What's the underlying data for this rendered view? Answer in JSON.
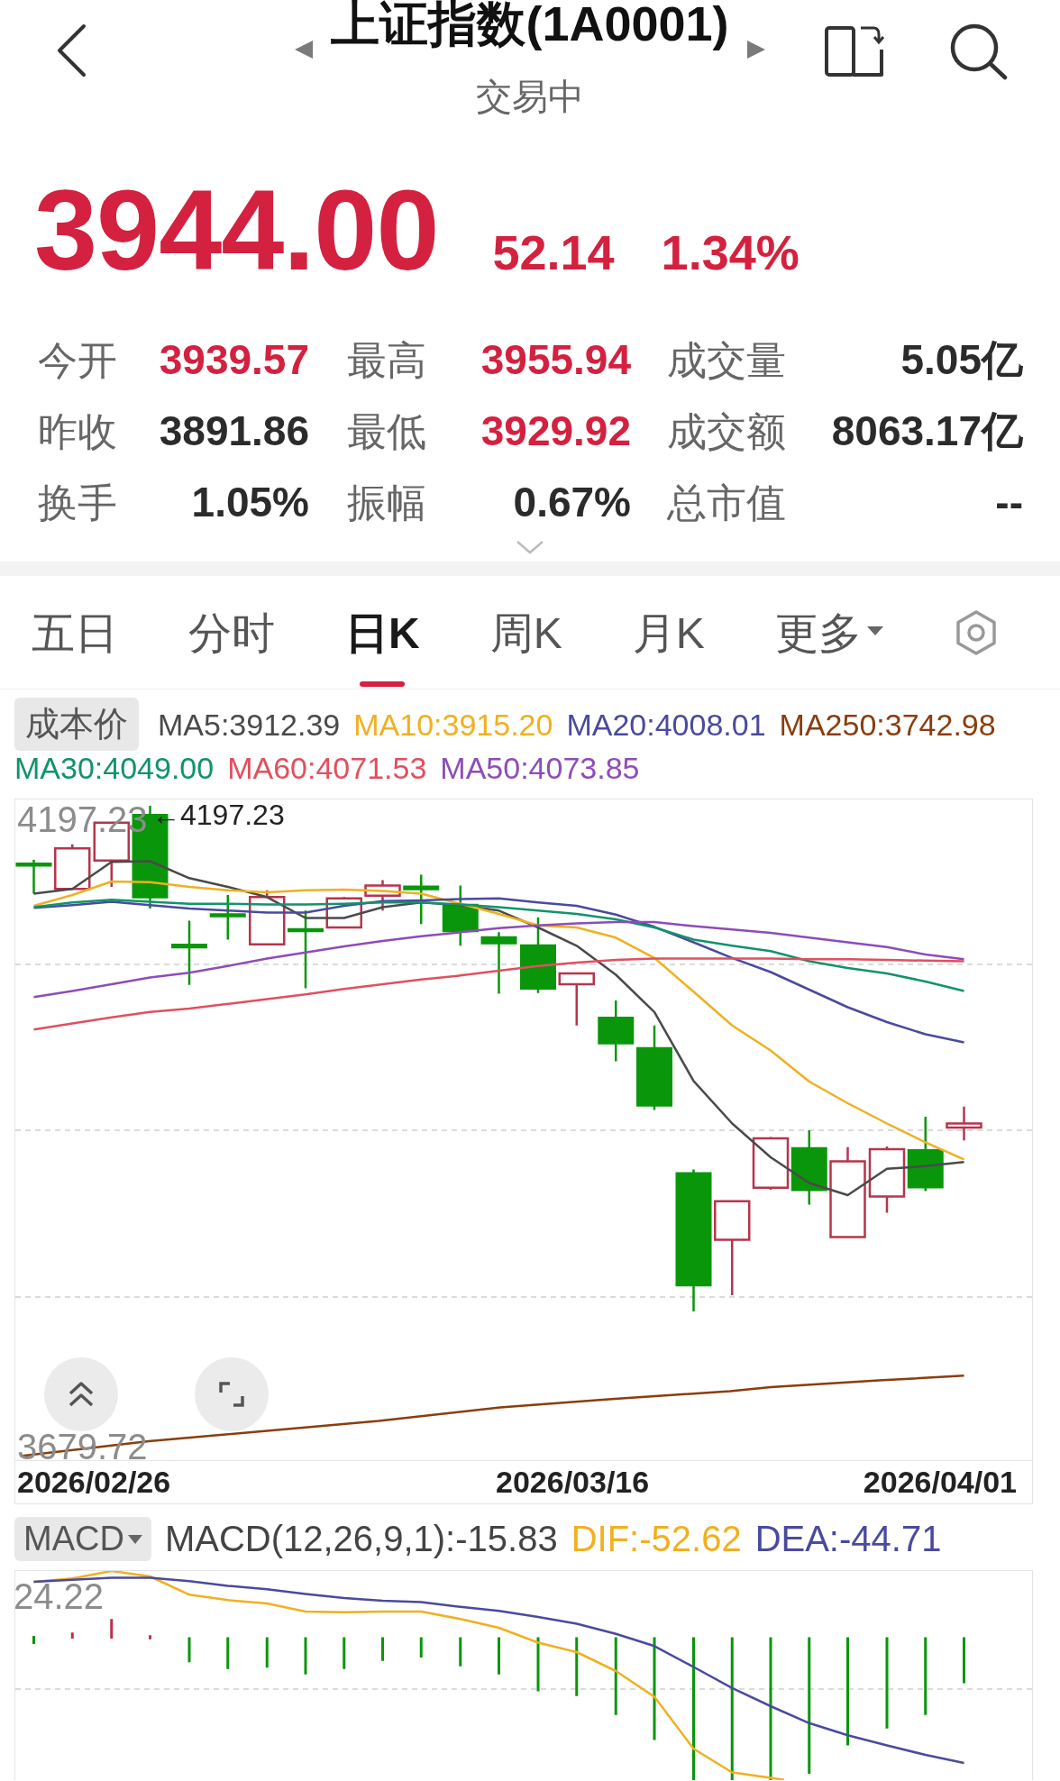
{
  "header": {
    "title": "上证指数(1A0001)",
    "status": "交易中"
  },
  "quote": {
    "price": "3944.00",
    "change": "52.14",
    "change_percent": "1.34%",
    "rising": true
  },
  "stats": [
    {
      "label": "今开",
      "value": "3939.57",
      "rising": true
    },
    {
      "label": "最高",
      "value": "3955.94",
      "rising": true
    },
    {
      "label": "成交量",
      "value": "5.05亿",
      "rising": false
    },
    {
      "label": "昨收",
      "value": "3891.86",
      "rising": false
    },
    {
      "label": "最低",
      "value": "3929.92",
      "rising": true
    },
    {
      "label": "成交额",
      "value": "8063.17亿",
      "rising": false
    },
    {
      "label": "换手",
      "value": "1.05%",
      "rising": false
    },
    {
      "label": "振幅",
      "value": "0.67%",
      "rising": false
    },
    {
      "label": "总市值",
      "value": "--",
      "rising": false
    }
  ],
  "tabs": [
    {
      "label": "五日",
      "selected": false,
      "kind": "plain"
    },
    {
      "label": "分时",
      "selected": false,
      "kind": "plain"
    },
    {
      "label": "日K",
      "selected": true,
      "kind": "plain"
    },
    {
      "label": "周K",
      "selected": false,
      "kind": "plain"
    },
    {
      "label": "月K",
      "selected": false,
      "kind": "plain"
    },
    {
      "label": "更多",
      "selected": false,
      "kind": "dropdown"
    }
  ],
  "indicators": {
    "chip": "成本价",
    "averages": [
      {
        "label": "MA5:3912.39",
        "color": "#4a4a4a"
      },
      {
        "label": "MA10:3915.20",
        "color": "#f0b020"
      },
      {
        "label": "MA20:4008.01",
        "color": "#4a4a9e"
      },
      {
        "label": "MA250:3742.98",
        "color": "#8b3d0c"
      },
      {
        "label": "MA30:4049.00",
        "color": "#11936b"
      },
      {
        "label": "MA60:4071.53",
        "color": "#e0505f"
      },
      {
        "label": "MA50:4073.85",
        "color": "#8e4cb8"
      }
    ]
  },
  "kline_chart": {
    "max_label": "4197.23",
    "high_marker": "←4197.23",
    "min_label": "3679.72",
    "dates": [
      "2026/02/26",
      "2026/03/16",
      "2026/04/01"
    ]
  },
  "macd": {
    "selector": "MACD",
    "readouts": [
      {
        "label": "MACD(12,26,9,1):-15.83",
        "color": "#444444"
      },
      {
        "label": "DIF:-52.62",
        "color": "#f0b020"
      },
      {
        "label": "DEA:-44.71",
        "color": "#4a4a9e"
      }
    ],
    "max_label": "24.22"
  }
}
